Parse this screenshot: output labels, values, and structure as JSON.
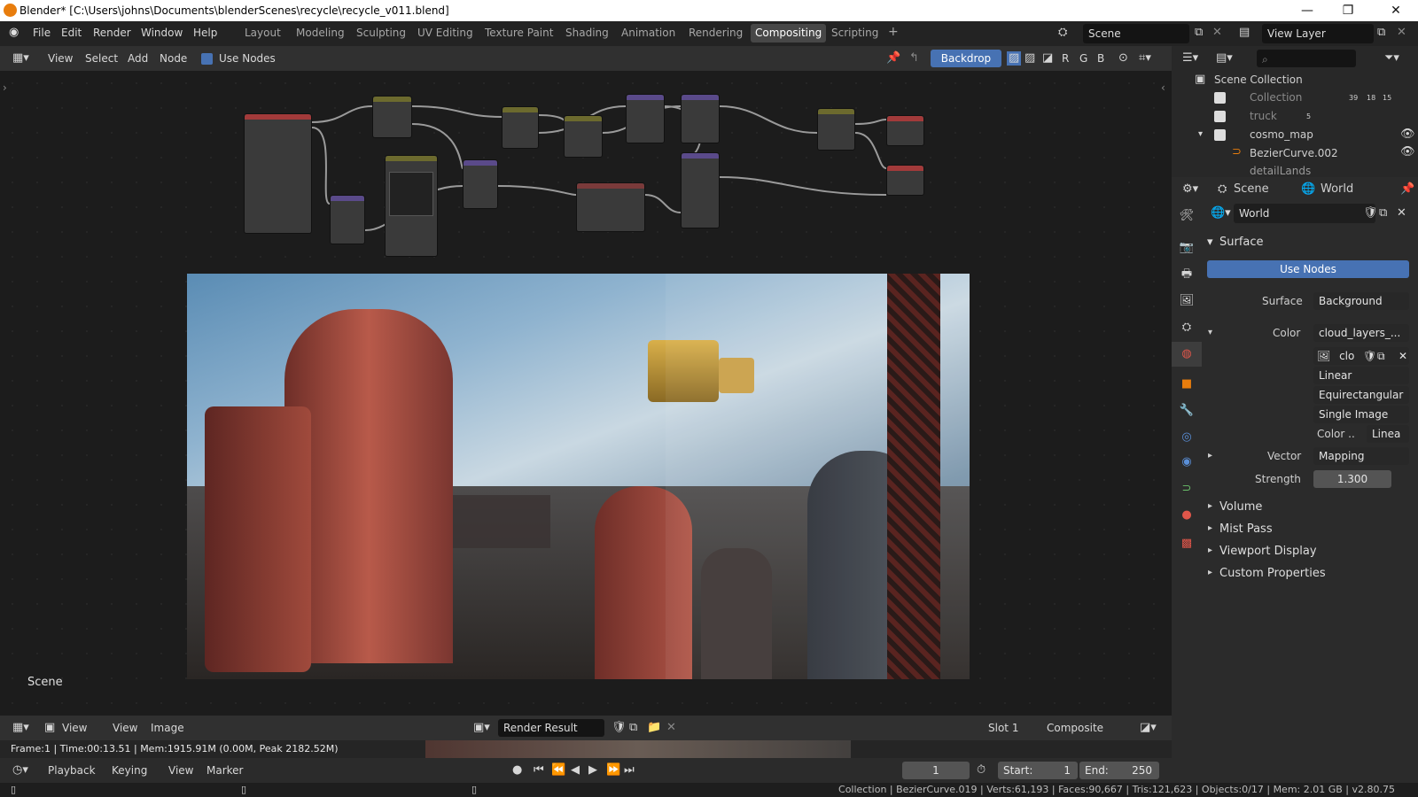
{
  "window": {
    "title": "Blender* [C:\\Users\\johns\\Documents\\blenderScenes\\recycle\\recycle_v011.blend]",
    "minimize": "—",
    "maximize": "❐",
    "close": "✕"
  },
  "menus": [
    "File",
    "Edit",
    "Render",
    "Window",
    "Help"
  ],
  "workspaces": [
    {
      "label": "Layout"
    },
    {
      "label": "Modeling"
    },
    {
      "label": "Sculpting"
    },
    {
      "label": "UV Editing"
    },
    {
      "label": "Texture Paint"
    },
    {
      "label": "Shading"
    },
    {
      "label": "Animation"
    },
    {
      "label": "Rendering"
    },
    {
      "label": "Compositing",
      "active": true
    },
    {
      "label": "Scripting"
    }
  ],
  "add_workspace": "+",
  "scene_field": "Scene",
  "view_layer_field": "View Layer",
  "node_header": {
    "view": "View",
    "select": "Select",
    "add": "Add",
    "node": "Node",
    "use_nodes": "Use Nodes",
    "backdrop": "Backdrop",
    "channels": [
      "R",
      "G",
      "B"
    ]
  },
  "node_area": {
    "scene_label": "Scene"
  },
  "image_header": {
    "view1": "View",
    "view2": "View",
    "image": "Image",
    "result": "Render Result",
    "slot": "Slot 1",
    "composite": "Composite"
  },
  "status_line": "Frame:1 | Time:00:13.51 | Mem:1915.91M (0.00M, Peak 2182.52M)",
  "timeline": {
    "playback": "Playback",
    "keying": "Keying",
    "view": "View",
    "marker": "Marker",
    "current_frame": "1",
    "start_label": "Start:",
    "start": "1",
    "end_label": "End:",
    "end": "250"
  },
  "statusbar": "Collection | BezierCurve.019 | Verts:61,193 | Faces:90,667 | Tris:121,623 | Objects:0/17 | Mem: 2.01 GB | v2.80.75",
  "outliner": {
    "title": "Scene Collection",
    "items": [
      {
        "name": "Collection",
        "count1": "39",
        "count2": "18",
        "count3": "15"
      },
      {
        "name": "truck",
        "count": "5"
      },
      {
        "name": "cosmo_map"
      },
      {
        "name": "BezierCurve.002"
      },
      {
        "name": "detailLands"
      }
    ]
  },
  "props": {
    "breadcrumb_scene": "Scene",
    "breadcrumb_world": "World",
    "world_name": "World",
    "surface_panel": "Surface",
    "use_nodes_btn": "Use Nodes",
    "surface_label": "Surface",
    "surface_value": "Background",
    "color_label": "Color",
    "color_value": "cloud_layers_...",
    "image_short": "clo",
    "interp": "Linear",
    "projection": "Equirectangular",
    "source": "Single Image",
    "colorspace_label": "Color ..",
    "colorspace_value": "Linea",
    "vector_label": "Vector",
    "vector_value": "Mapping",
    "strength_label": "Strength",
    "strength_value": "1.300",
    "panels": [
      "Volume",
      "Mist Pass",
      "Viewport Display",
      "Custom Properties"
    ]
  },
  "colors": {
    "accent": "#4772b3",
    "active_ws": "#474747",
    "blender_orange": "#e87d0d"
  }
}
